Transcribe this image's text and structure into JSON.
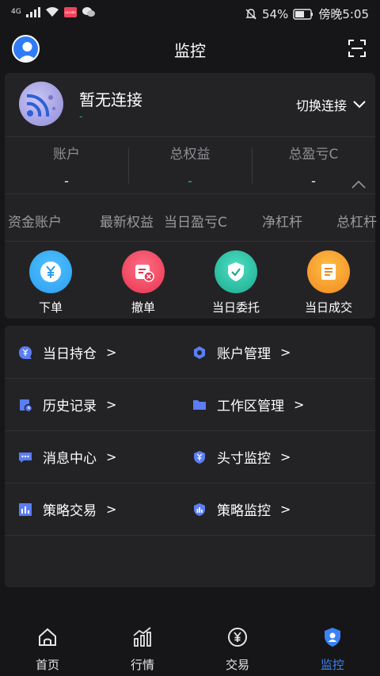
{
  "status_bar": {
    "network": "4G",
    "battery": "54%",
    "time": "傍晚5:05",
    "notification_badge": "Lazada"
  },
  "header": {
    "title": "监控",
    "avatar_icon": "user-avatar-icon",
    "scan_icon": "scan-icon"
  },
  "connection": {
    "name": "暂无连接",
    "subtext": "-",
    "switch_label": "切换连接"
  },
  "metrics": [
    {
      "label": "账户",
      "value": "-"
    },
    {
      "label": "总权益",
      "value": "-"
    },
    {
      "label": "总盈亏C",
      "value": "-"
    }
  ],
  "tabs": [
    "资金账户",
    "最新权益",
    "当日盈亏C",
    "净杠杆",
    "总杠杆"
  ],
  "actions": [
    {
      "label": "下单",
      "color": "#2d9cf0",
      "icon": "yuan-icon"
    },
    {
      "label": "撤单",
      "color": "#f0435a",
      "icon": "cancel-order-icon"
    },
    {
      "label": "当日委托",
      "color": "#1fbfa3",
      "icon": "shield-check-icon"
    },
    {
      "label": "当日成交",
      "color": "#f6921e",
      "icon": "document-list-icon"
    }
  ],
  "menu": [
    {
      "label": "当日持仓",
      "icon": "position-icon"
    },
    {
      "label": "账户管理",
      "icon": "hexagon-settings-icon"
    },
    {
      "label": "历史记录",
      "icon": "history-icon"
    },
    {
      "label": "工作区管理",
      "icon": "folder-icon"
    },
    {
      "label": "消息中心",
      "icon": "message-icon"
    },
    {
      "label": "头寸监控",
      "icon": "shield-yuan-icon"
    },
    {
      "label": "策略交易",
      "icon": "chart-bars-icon"
    },
    {
      "label": "策略监控",
      "icon": "shield-chart-icon"
    }
  ],
  "nav": [
    {
      "label": "首页",
      "icon": "home-icon",
      "active": false
    },
    {
      "label": "行情",
      "icon": "trend-chart-icon",
      "active": false
    },
    {
      "label": "交易",
      "icon": "yuan-exchange-icon",
      "active": false
    },
    {
      "label": "监控",
      "icon": "shield-user-icon",
      "active": true
    }
  ],
  "colors": {
    "accent": "#2f7cf6",
    "active_nav": "#3b82f6",
    "positive": "#1abc9c"
  }
}
